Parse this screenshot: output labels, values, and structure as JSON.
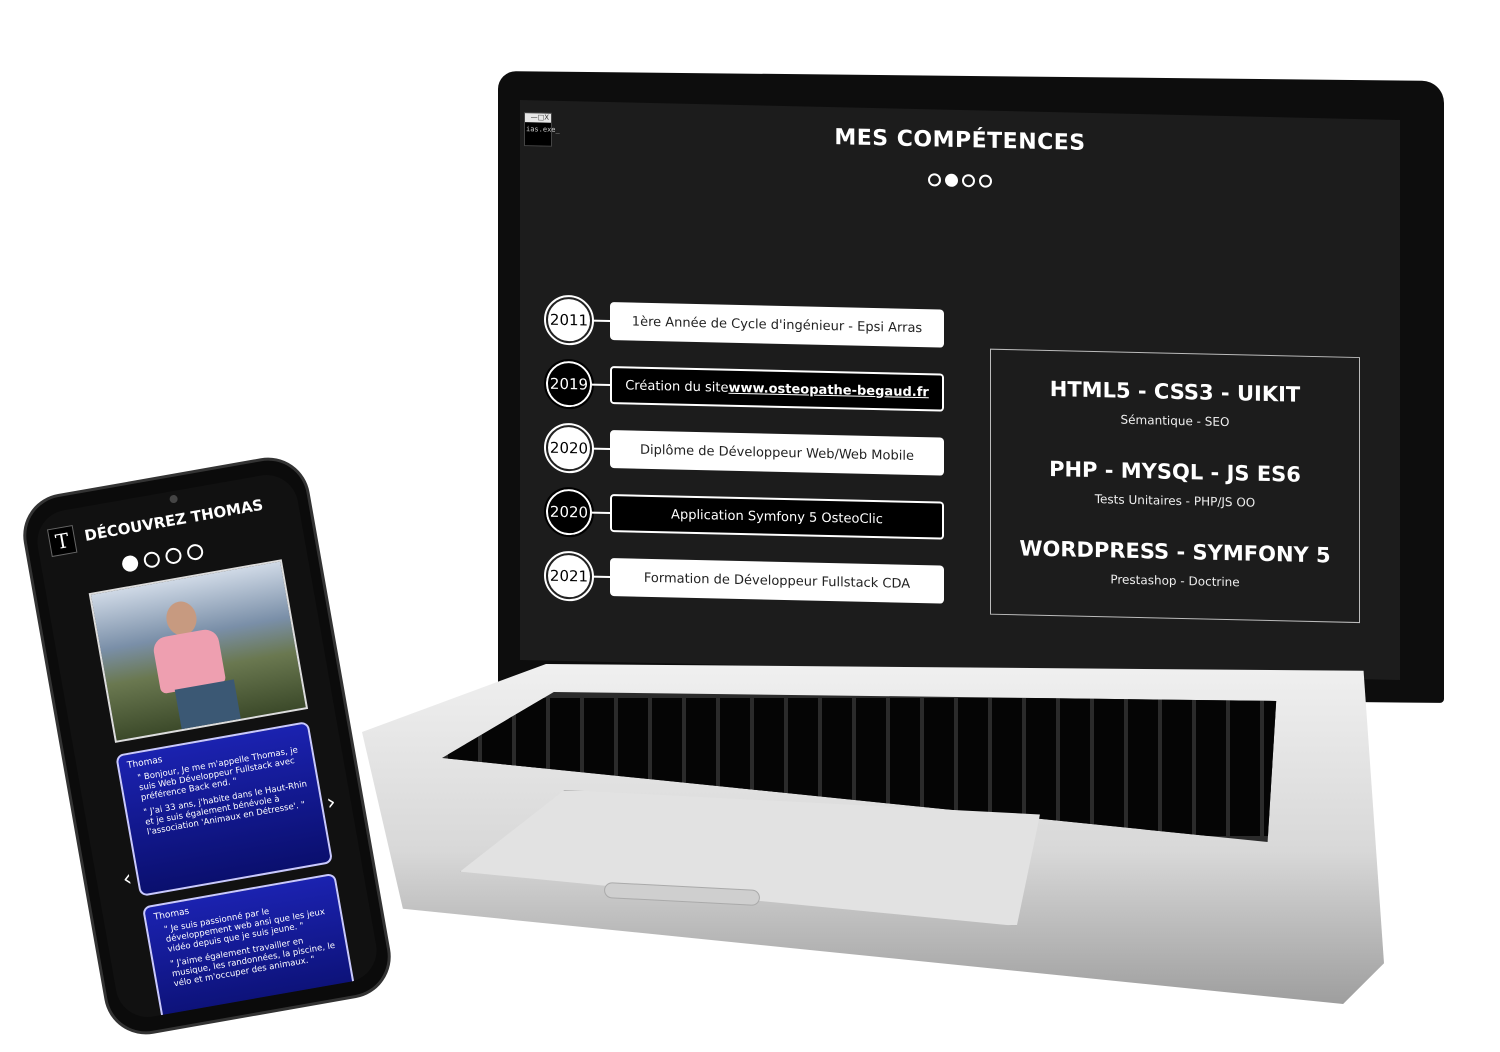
{
  "laptop": {
    "window_widget": {
      "controls": "—□X",
      "label": "ias.exe_"
    },
    "title": "MES COMPÉTENCES",
    "carousel": {
      "count": 4,
      "active_index": 1
    },
    "timeline": [
      {
        "year": "2011",
        "text": "1ère Année de Cycle d'ingénieur - Epsi Arras",
        "style": "light"
      },
      {
        "year": "2019",
        "text": "Création du site",
        "link": "www.osteopathe-begaud.fr",
        "style": "dark"
      },
      {
        "year": "2020",
        "text": "Diplôme de Développeur Web/Web Mobile",
        "style": "light"
      },
      {
        "year": "2020",
        "text": "Application Symfony 5 OsteoClic",
        "style": "dark"
      },
      {
        "year": "2021",
        "text": "Formation de Développeur Fullstack CDA",
        "style": "light"
      }
    ],
    "skills": [
      {
        "main": "HTML5 - CSS3 - UIKIT",
        "sub": "Sémantique - SEO"
      },
      {
        "main": "PHP - MYSQL - JS ES6",
        "sub": "Tests Unitaires - PHP/JS OO"
      },
      {
        "main": "WORDPRESS - SYMFONY 5",
        "sub": "Prestashop - Doctrine"
      }
    ]
  },
  "phone": {
    "logo": "T",
    "title": "DÉCOUVREZ THOMAS",
    "carousel": {
      "count": 4,
      "active_index": 0
    },
    "messages": [
      {
        "name": "Thomas",
        "lines": [
          "\" Bonjour,  Je me m'appelle Thomas, je suis Web Développeur Fullstack avec préférence Back end. \"",
          "\" J'ai 33 ans,  j'habite dans le Haut-Rhin et je suis également bénévole à l'association 'Animaux en Détresse'. \""
        ]
      },
      {
        "name": "Thomas",
        "lines": [
          "\" Je suis passionné par le développement web ansi que les jeux vidéo depuis que je suis jeune. \"",
          "\" J'aime également travailler en musique,  les randonnées, la piscine, le vélo et m'occuper des animaux. \""
        ]
      }
    ],
    "nav": {
      "prev": "‹",
      "next": "›"
    }
  },
  "colors": {
    "screen_bg": "#1c1c1c",
    "message_bg": "#1b22b0"
  }
}
